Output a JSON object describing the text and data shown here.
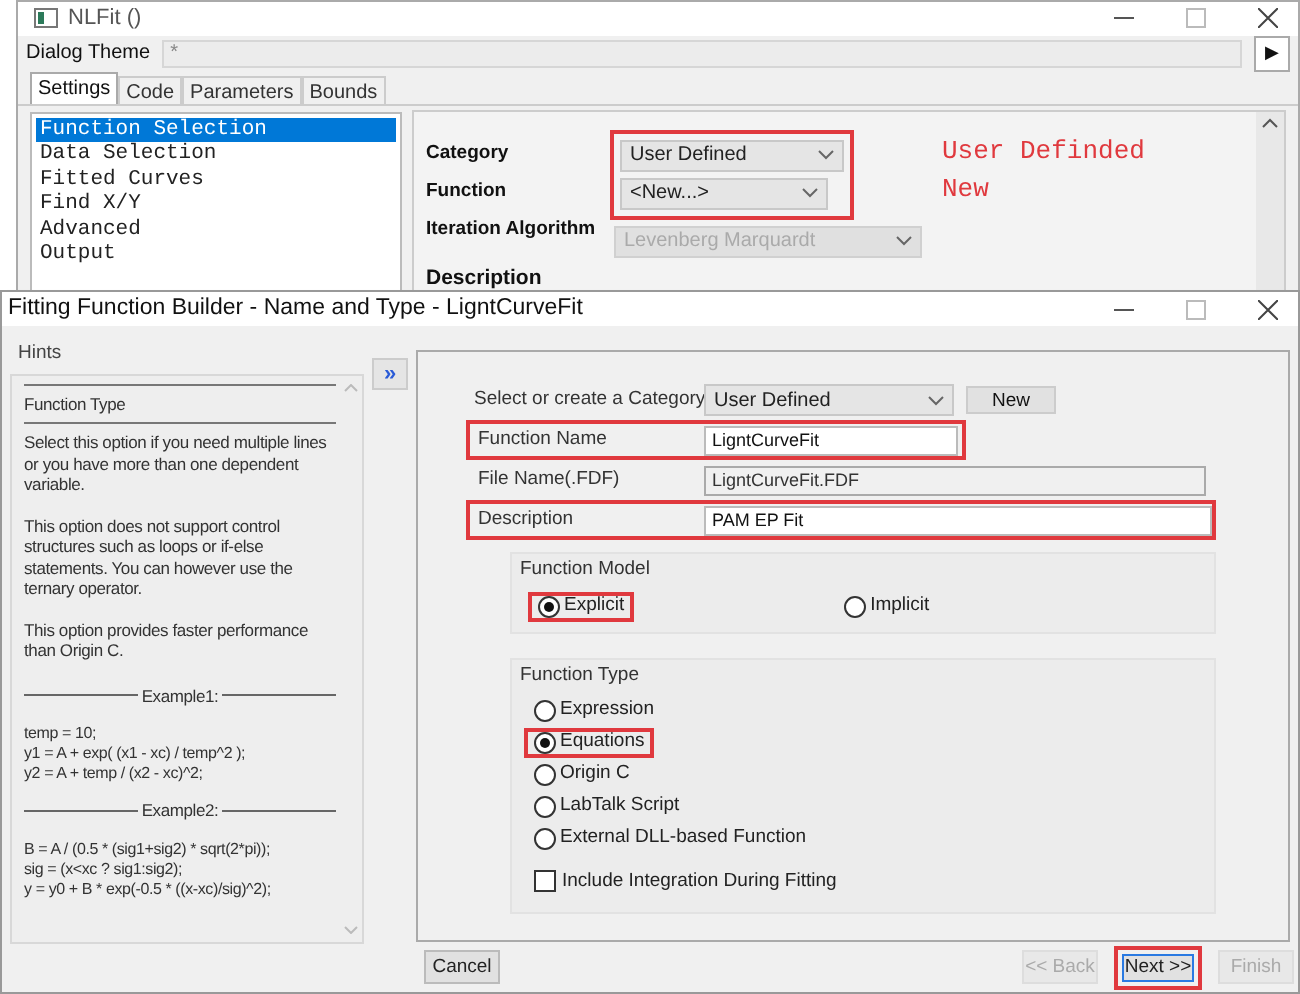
{
  "back_window": {
    "title": "NLFit ()",
    "theme_label": "Dialog Theme",
    "theme_value": "*",
    "theme_button": "▶",
    "tabs": [
      {
        "label": "Settings",
        "selected": true
      },
      {
        "label": "Code",
        "selected": false
      },
      {
        "label": "Parameters",
        "selected": false
      },
      {
        "label": "Bounds",
        "selected": false
      }
    ],
    "list": [
      {
        "label": "Function Selection",
        "selected": true
      },
      {
        "label": "Data Selection",
        "selected": false
      },
      {
        "label": "Fitted Curves",
        "selected": false
      },
      {
        "label": "Find X/Y",
        "selected": false
      },
      {
        "label": "Advanced",
        "selected": false
      },
      {
        "label": "Output",
        "selected": false
      }
    ],
    "fields": [
      {
        "label": "Category",
        "value": "User Defined",
        "disabled": false,
        "highlighted": true
      },
      {
        "label": "Function",
        "value": "<New...>",
        "disabled": false,
        "highlighted": true
      },
      {
        "label": "Iteration Algorithm",
        "value": "Levenberg Marquardt",
        "disabled": true,
        "highlighted": false
      }
    ],
    "section_label": "Description",
    "annotations": [
      "User Definded",
      "New"
    ]
  },
  "front_window": {
    "title": "Fitting Function Builder - Name and Type - LigntCurveFit",
    "hints_label": "Hints",
    "hints": [
      {
        "kind": "heading",
        "text": "Function Type"
      },
      {
        "kind": "paragraph",
        "text": "Select this option if you need multiple lines or you have more than one dependent variable."
      },
      {
        "kind": "paragraph",
        "text": "This option does not support control structures such as loops or if-else statements. You can however use the ternary operator."
      },
      {
        "kind": "paragraph",
        "text": "This option provides faster performance than Origin C."
      },
      {
        "kind": "divider",
        "text": "Example1:"
      },
      {
        "kind": "code",
        "text": "temp = 10;"
      },
      {
        "kind": "code",
        "text": "y1 = A + exp( (x1 - xc) / temp^2 );"
      },
      {
        "kind": "code",
        "text": "y2 = A + temp / (x2 - xc)^2;"
      },
      {
        "kind": "divider",
        "text": "Example2:"
      },
      {
        "kind": "code",
        "text": "B = A / (0.5 * (sig1+sig2) * sqrt(2*pi));"
      },
      {
        "kind": "code",
        "text": "sig = (x<xc ? sig1:sig2);"
      },
      {
        "kind": "code",
        "text": "y = y0 + B * exp(-0.5 * ((x-xc)/sig)^2);"
      }
    ],
    "toggle_button": "»",
    "category_label": "Select or create a Category",
    "category_value": "User Defined",
    "new_button": "New",
    "fields": [
      {
        "label": "Function Name",
        "value": "LigntCurveFit",
        "readonly": false,
        "highlighted": true
      },
      {
        "label": "File Name(.FDF)",
        "value": "LigntCurveFit.FDF",
        "readonly": true,
        "highlighted": false
      },
      {
        "label": "Description",
        "value": "PAM EP Fit",
        "readonly": false,
        "highlighted": true
      }
    ],
    "model_label": "Function Model",
    "model_options": [
      {
        "label": "Explicit",
        "selected": true,
        "highlighted": true
      },
      {
        "label": "Implicit",
        "selected": false,
        "highlighted": false
      }
    ],
    "type_label": "Function Type",
    "type_options": [
      {
        "label": "Expression",
        "selected": false,
        "highlighted": false
      },
      {
        "label": "Equations",
        "selected": true,
        "highlighted": true
      },
      {
        "label": "Origin C",
        "selected": false,
        "highlighted": false
      },
      {
        "label": "LabTalk Script",
        "selected": false,
        "highlighted": false
      },
      {
        "label": "External DLL-based Function",
        "selected": false,
        "highlighted": false
      }
    ],
    "include_integration": {
      "label": "Include Integration During Fitting",
      "checked": false
    },
    "buttons": [
      {
        "label": "Cancel",
        "disabled": false,
        "highlighted": false
      },
      {
        "label": "<< Back",
        "disabled": true,
        "highlighted": false
      },
      {
        "label": "Next >>",
        "disabled": false,
        "highlighted": true
      },
      {
        "label": "Finish",
        "disabled": true,
        "highlighted": false
      }
    ]
  }
}
